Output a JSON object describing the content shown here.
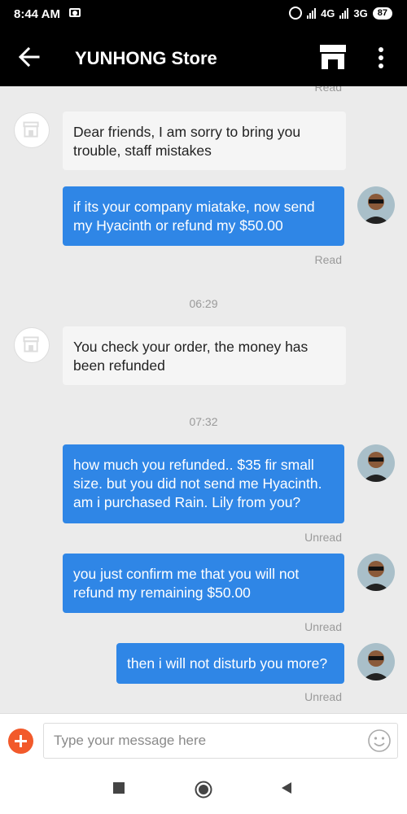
{
  "status_bar": {
    "time": "8:44 AM",
    "network1": "4G",
    "network2": "3G",
    "battery": "87"
  },
  "header": {
    "title": "YUNHONG Store"
  },
  "chat": {
    "top_status": "Read",
    "messages": [
      {
        "from": "store",
        "lines": [
          "Dear friends, I am sorry to bring you",
          "trouble, staff mistakes"
        ]
      },
      {
        "from": "user",
        "lines": [
          "if its your company miatake, now send",
          "my Hyacinth or refund my $50.00"
        ],
        "status": "Read"
      },
      {
        "timestamp": "06:29"
      },
      {
        "from": "store",
        "lines": [
          "You check your order, the money has",
          "been refunded"
        ]
      },
      {
        "timestamp": "07:32"
      },
      {
        "from": "user",
        "lines": [
          "how much you refunded.. $35 fir small",
          "size. but you did not send me Hyacinth.",
          "am i purchased Rain. Lily from you?"
        ],
        "status": "Unread"
      },
      {
        "from": "user",
        "lines": [
          "you just confirm me that you will not",
          "refund my remaining $50.00"
        ],
        "status": "Unread"
      },
      {
        "from": "user",
        "lines": [
          "then i will not disturb you more?"
        ],
        "status": "Unread"
      }
    ]
  },
  "input": {
    "placeholder": "Type your message here"
  },
  "icons": {
    "back": "back-arrow-icon",
    "store": "store-icon",
    "more": "more-vertical-icon",
    "attach": "plus-icon",
    "emoji": "smiley-icon",
    "nav_recents": "square-icon",
    "nav_home": "circle-icon",
    "nav_back": "triangle-back-icon"
  },
  "colors": {
    "header": "#000000",
    "outgoing_bubble": "#2f86e6",
    "incoming_bubble": "#f5f5f5",
    "background": "#ebebeb",
    "accent": "#f25a2b"
  }
}
